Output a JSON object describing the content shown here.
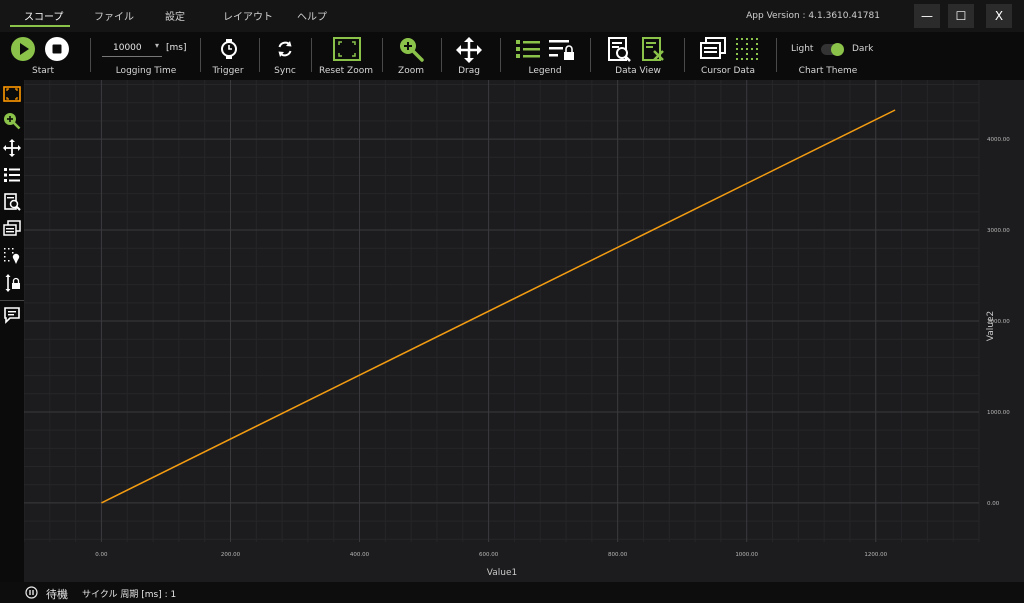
{
  "menu": {
    "items": [
      "スコープ",
      "ファイル",
      "設定",
      "レイアウト",
      "ヘルプ"
    ],
    "active": "スコープ",
    "app_version": "App Version : 4.1.3610.41781",
    "window_buttons": {
      "minimize": "—",
      "maximize": "☐",
      "close": "X"
    }
  },
  "toolbar": {
    "start": "Start",
    "logging_value": "10000",
    "logging_unit": "[ms]",
    "logging_time": "Logging Time",
    "trigger": "Trigger",
    "sync": "Sync",
    "reset_zoom": "Reset Zoom",
    "zoom": "Zoom",
    "drag": "Drag",
    "legend": "Legend",
    "data_view": "Data View",
    "cursor_data": "Cursor Data",
    "theme_light": "Light",
    "theme_dark": "Dark",
    "chart_theme": "Chart Theme"
  },
  "colors": {
    "accent": "#8bc34a",
    "series": "#f39c12",
    "active_icon": "#ff9800"
  },
  "status": {
    "state": "待機",
    "cycle": "サイクル 周期 [ms] : 1"
  },
  "chart_data": {
    "type": "line",
    "xlabel": "Value1",
    "ylabel": "Value2",
    "x_ticks": [
      "0.00",
      "200.00",
      "400.00",
      "600.00",
      "800.00",
      "1000.00",
      "1200.00"
    ],
    "y_ticks": [
      "0.00",
      "1000.00",
      "2000.00",
      "3000.00",
      "4000.00"
    ],
    "xlim": [
      -120,
      1360
    ],
    "ylim": [
      -430,
      4650
    ],
    "grid": true,
    "series": [
      {
        "x": [
          0,
          1230
        ],
        "y": [
          0,
          4320
        ]
      }
    ]
  }
}
